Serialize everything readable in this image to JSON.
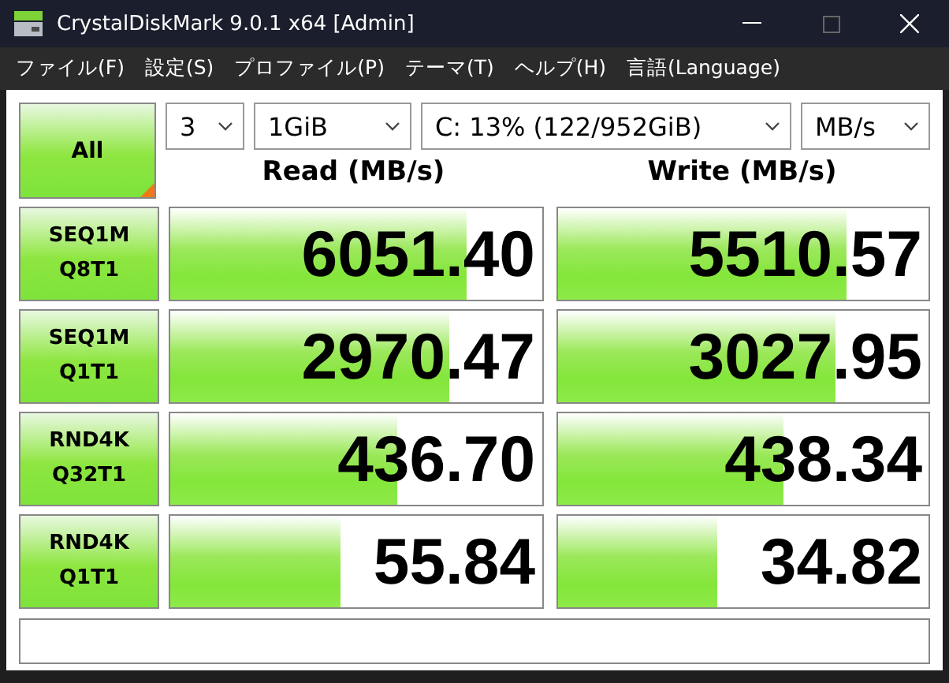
{
  "window": {
    "title": "CrystalDiskMark 9.0.1 x64 [Admin]"
  },
  "menu": [
    "ファイル(F)",
    "設定(S)",
    "プロファイル(P)",
    "テーマ(T)",
    "ヘルプ(H)",
    "言語(Language)"
  ],
  "toolbar": {
    "all_button": "All",
    "count": "3",
    "size": "1GiB",
    "drive": "C: 13% (122/952GiB)",
    "unit": "MB/s"
  },
  "headers": {
    "read": "Read (MB/s)",
    "write": "Write (MB/s)"
  },
  "tests": [
    {
      "name": "SEQ1M",
      "params": "Q8T1",
      "read": {
        "value": "6051.40",
        "level": 0.8
      },
      "write": {
        "value": "5510.57",
        "level": 0.78
      }
    },
    {
      "name": "SEQ1M",
      "params": "Q1T1",
      "read": {
        "value": "2970.47",
        "level": 0.75
      },
      "write": {
        "value": "3027.95",
        "level": 0.75
      }
    },
    {
      "name": "RND4K",
      "params": "Q32T1",
      "read": {
        "value": "436.70",
        "level": 0.61
      },
      "write": {
        "value": "438.34",
        "level": 0.61
      }
    },
    {
      "name": "RND4K",
      "params": "Q1T1",
      "read": {
        "value": "55.84",
        "level": 0.46
      },
      "write": {
        "value": "34.82",
        "level": 0.43
      }
    }
  ]
}
